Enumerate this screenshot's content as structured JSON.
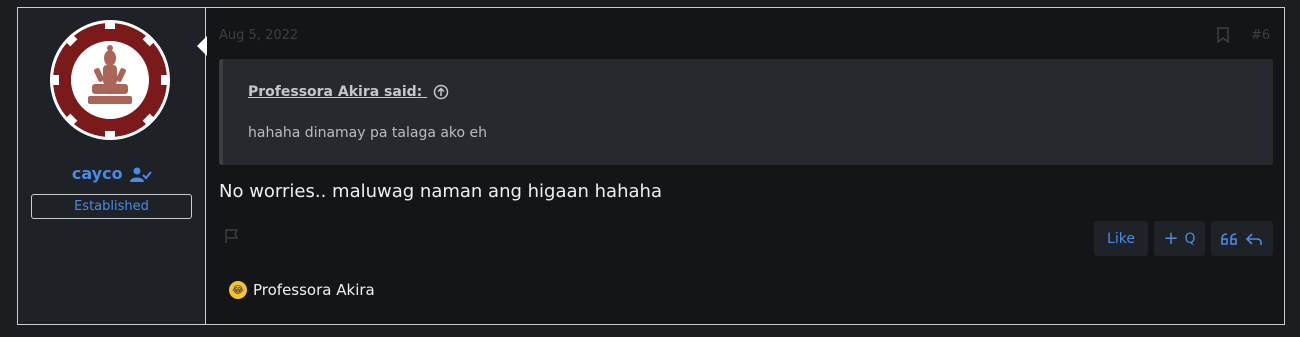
{
  "post": {
    "user": {
      "name": "cayco",
      "badge": "Established"
    },
    "date": "Aug 5, 2022",
    "number": "#6",
    "quote": {
      "author": "Professora Akira said:",
      "text": "hahaha dinamay pa talaga ako eh"
    },
    "message": "No worries.. maluwag naman ang higaan hahaha",
    "actions": {
      "like": "Like",
      "plus": "+",
      "q": "Q"
    },
    "reactions": {
      "names": "Professora Akira",
      "icon": "laughing-emoji"
    }
  },
  "colors": {
    "accent": "#4a8be8",
    "background": "#141517",
    "user_pane": "#1e2125",
    "quote_bg": "#26292e"
  }
}
